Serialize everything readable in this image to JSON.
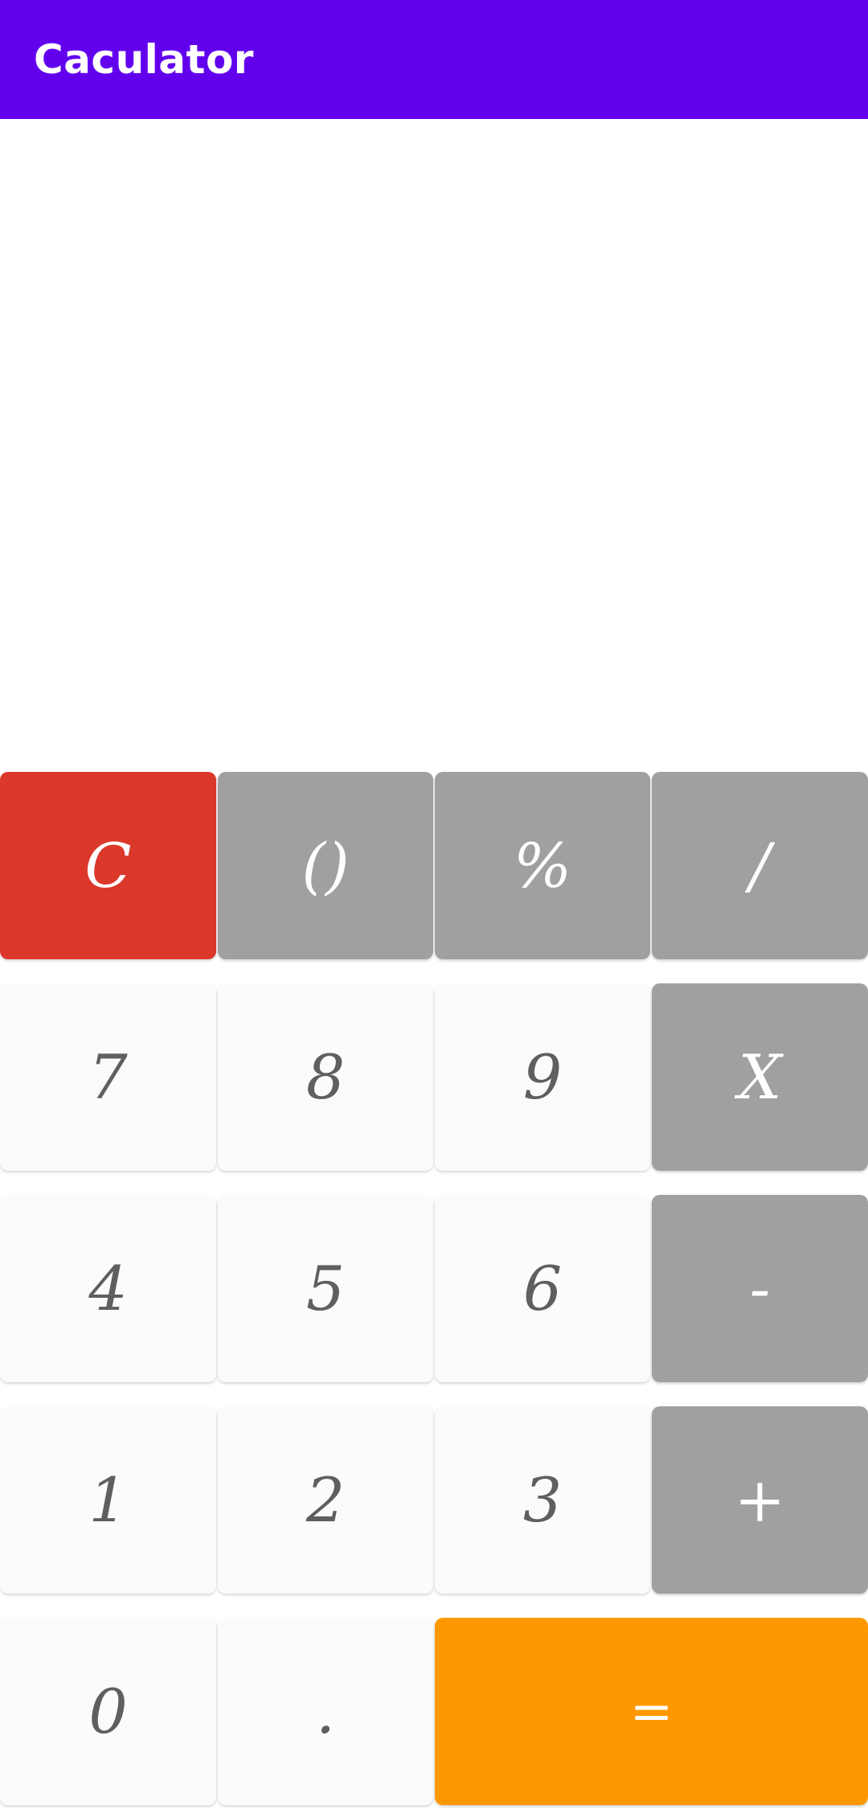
{
  "app": {
    "title": "Caculator",
    "colors": {
      "toolbar": "#6200ee",
      "clear_key": "#db372b",
      "operator_key": "#a0a0a0",
      "number_key": "#fbfbfb",
      "equals_key": "#fe9800"
    }
  },
  "display": {
    "value": ""
  },
  "keys": {
    "clear": "C",
    "parentheses": "()",
    "percent": "%",
    "divide": "/",
    "seven": "7",
    "eight": "8",
    "nine": "9",
    "multiply": "X",
    "four": "4",
    "five": "5",
    "six": "6",
    "minus": "-",
    "one": "1",
    "two": "2",
    "three": "3",
    "plus": "+",
    "zero": "0",
    "decimal": ".",
    "equals": "="
  }
}
